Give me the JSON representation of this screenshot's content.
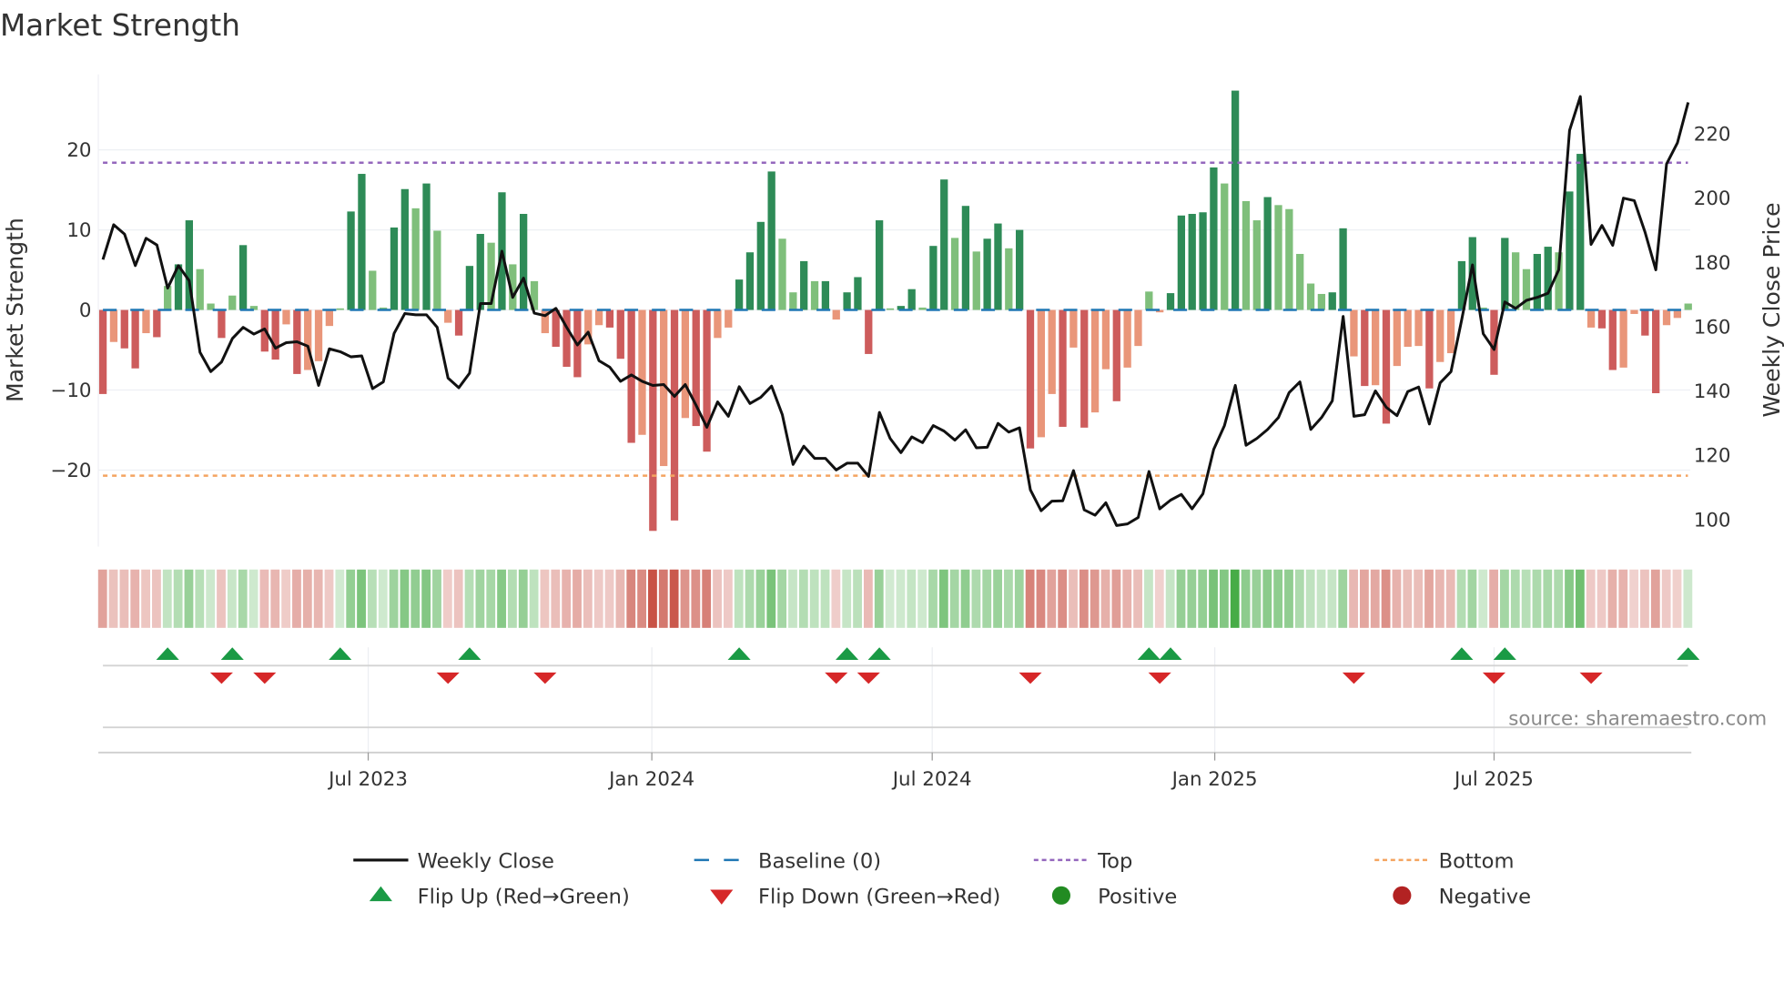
{
  "title": "Market Strength",
  "source": "source: sharemaestro.com",
  "colors": {
    "pos_strong": "#2e8b57",
    "pos_weak": "#7fbf7b",
    "neg_strong": "#cd5c5c",
    "neg_weak": "#e9967a",
    "close": "#111111",
    "baseline": "#1f77b4",
    "top": "#9467bd",
    "bottom": "#f4a460",
    "flip_up": "#1a9a45",
    "flip_down": "#d62728",
    "positive": "#228b22",
    "negative": "#b22222"
  },
  "chart_data": {
    "type": "bar",
    "title": "Market Strength",
    "ylabel": "Market Strength",
    "y2label": "Weekly Close Price",
    "ylim": [
      -29,
      29
    ],
    "y2lim": [
      93,
      240
    ],
    "y_ticks": [
      {
        "v": 20,
        "label": "20"
      },
      {
        "v": 10,
        "label": "10"
      },
      {
        "v": 0,
        "label": "0"
      },
      {
        "v": -10,
        "label": "−10"
      },
      {
        "v": -20,
        "label": "−20"
      }
    ],
    "y2_ticks": [
      {
        "v": 220,
        "label": "220"
      },
      {
        "v": 200,
        "label": "200"
      },
      {
        "v": 180,
        "label": "180"
      },
      {
        "v": 160,
        "label": "160"
      },
      {
        "v": 140,
        "label": "140"
      },
      {
        "v": 120,
        "label": "120"
      },
      {
        "v": 100,
        "label": "100"
      }
    ],
    "x_ticks": [
      {
        "week": 24.6,
        "label": "Jul 2023"
      },
      {
        "week": 50.9,
        "label": "Jan 2024"
      },
      {
        "week": 76.9,
        "label": "Jul 2024"
      },
      {
        "week": 103.1,
        "label": "Jan 2025"
      },
      {
        "week": 129.0,
        "label": "Jul 2025"
      }
    ],
    "top_level": 18.4,
    "bottom_level": -20.7,
    "baseline": 0,
    "strength": [
      -10.5,
      -4,
      -4.8,
      -7.3,
      -2.9,
      -3.4,
      3,
      5.7,
      11.2,
      5.1,
      0.8,
      -3.5,
      1.8,
      8.1,
      0.5,
      -5.2,
      -6.2,
      -1.8,
      -8,
      -7.5,
      -6.4,
      -2,
      0.2,
      12.3,
      17,
      4.9,
      0.3,
      10.3,
      15.1,
      12.7,
      15.8,
      9.9,
      -1.6,
      -3.2,
      5.5,
      9.5,
      8.4,
      14.7,
      5.7,
      12,
      3.6,
      -2.9,
      -4.6,
      -7.1,
      -8.4,
      -4.3,
      -1.9,
      -2.2,
      -6.1,
      -16.6,
      -15.6,
      -27.6,
      -19.5,
      -26.3,
      -13.5,
      -14.5,
      -17.7,
      -3.5,
      -2.2,
      3.8,
      7.2,
      11,
      17.3,
      8.9,
      2.2,
      6.1,
      3.6,
      3.6,
      -1.2,
      2.2,
      4.1,
      -5.5,
      11.2,
      0.2,
      0.5,
      2.6,
      0.3,
      8,
      16.3,
      9,
      13,
      7.3,
      8.9,
      10.8,
      7.7,
      10,
      -17.3,
      -15.9,
      -10.5,
      -14.6,
      -4.7,
      -14.7,
      -12.8,
      -7.4,
      -11.4,
      -7.2,
      -4.5,
      2.3,
      -0.3,
      2.1,
      11.8,
      12,
      12.2,
      17.8,
      15.8,
      27.4,
      13.6,
      11.2,
      14.1,
      13.1,
      12.6,
      7,
      3.3,
      2,
      2.2,
      10.2,
      -5.8,
      -9.5,
      -9.4,
      -14.2,
      -7,
      -4.6,
      -4.5,
      -9.8,
      -6.5,
      -5.4,
      6.1,
      9.1,
      0.3,
      -8.1,
      9,
      7.2,
      5.1,
      7,
      7.9,
      7.2,
      14.8,
      19.5,
      -2.2,
      -2.3,
      -7.5,
      -7.2,
      -0.5,
      -3.2,
      -10.4,
      -1.9,
      -1,
      0.8
    ],
    "weekly_close": [
      180.9,
      191.7,
      188.8,
      179,
      187.5,
      185.4,
      172,
      179,
      174.3,
      152,
      146,
      149,
      156.3,
      159.8,
      157.7,
      159.3,
      153.3,
      155,
      155.3,
      153.9,
      141.7,
      153.1,
      152.2,
      150.6,
      150.9,
      140.7,
      142.8,
      157.9,
      164.1,
      163.7,
      163.7,
      159.8,
      144,
      141,
      145.5,
      167.2,
      167.2,
      183.5,
      169.1,
      175.1,
      164.2,
      163.4,
      165.7,
      159.8,
      154.3,
      158.3,
      149.4,
      147.4,
      143,
      145,
      143,
      141.7,
      142,
      138.3,
      142,
      135.6,
      128.7,
      136.6,
      132.1,
      141.3,
      136.1,
      138,
      141.5,
      132.6,
      117.1,
      122.8,
      119,
      119,
      115.4,
      117.5,
      117.5,
      113.4,
      133.3,
      125.2,
      120.8,
      125.7,
      123.9,
      129.2,
      127.5,
      124.7,
      127.9,
      122.3,
      122.5,
      129.9,
      127.2,
      128.5,
      109.2,
      102.7,
      105.7,
      105.8,
      115.2,
      103,
      101.3,
      105.2,
      98.1,
      98.6,
      100.6,
      114.9,
      103.3,
      106,
      107.8,
      103.3,
      108,
      121.8,
      129.2,
      141.7,
      123.1,
      125.2,
      128,
      131.7,
      139.5,
      142.8,
      128,
      131.7,
      136.9,
      163.2,
      132.1,
      132.6,
      140,
      134.9,
      132.3,
      139.8,
      141.2,
      129.7,
      142.5,
      146,
      162.2,
      179.2,
      157.8,
      152.9,
      167.7,
      165.7,
      168.2,
      169.1,
      170.4,
      177.7,
      221.1,
      231.6,
      185.6,
      191.5,
      185.3,
      200,
      199.2,
      189.4,
      177.7,
      210.6,
      217.2,
      229.8
    ],
    "flip_up_weeks": [
      6,
      12,
      22,
      34,
      59,
      69,
      72,
      97,
      99,
      126,
      130,
      147
    ],
    "flip_down_weeks": [
      11,
      15,
      32,
      41,
      68,
      71,
      86,
      98,
      116,
      129,
      138
    ],
    "legend": {
      "placement": "bottom",
      "items": [
        {
          "key": "close",
          "label": "Weekly Close",
          "symbol": "line"
        },
        {
          "key": "baseline",
          "label": "Baseline (0)",
          "symbol": "dash"
        },
        {
          "key": "top",
          "label": "Top",
          "symbol": "dot"
        },
        {
          "key": "bottom",
          "label": "Bottom",
          "symbol": "dot"
        },
        {
          "key": "flip_up",
          "label": "Flip Up (Red→Green)",
          "symbol": "tri-up"
        },
        {
          "key": "flip_down",
          "label": "Flip Down (Green→Red)",
          "symbol": "tri-down"
        },
        {
          "key": "positive",
          "label": "Positive",
          "symbol": "circle"
        },
        {
          "key": "negative",
          "label": "Negative",
          "symbol": "circle"
        }
      ]
    }
  }
}
